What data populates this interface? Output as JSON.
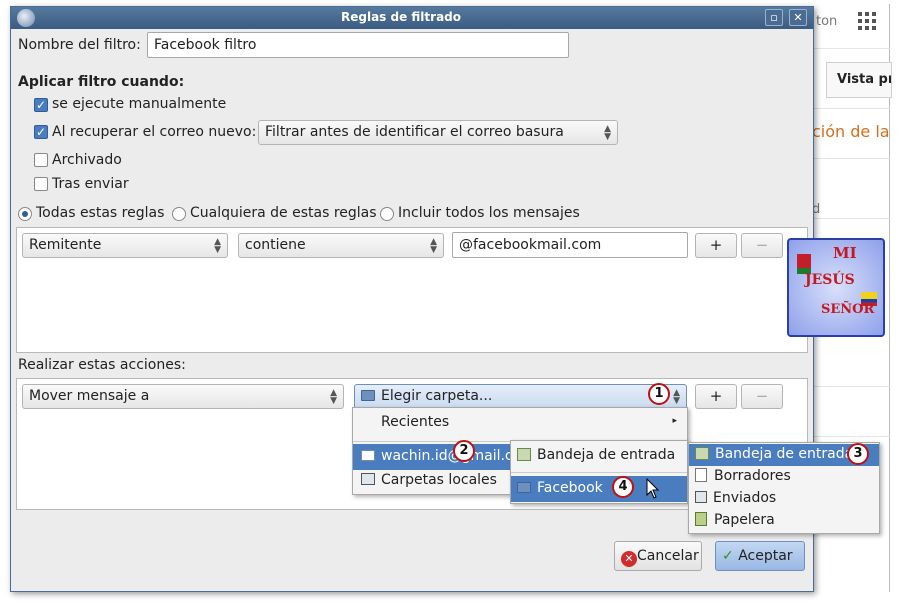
{
  "background_app": {
    "partial_header": "ton",
    "view_button": "Vista pre",
    "orange_text": "ción de la",
    "partial_letter": "d"
  },
  "dialog": {
    "title": "Reglas de filtrado",
    "filter_name_label": "Nombre del filtro:",
    "filter_name_value": "Facebook filtro",
    "apply_when_label": "Aplicar filtro cuando:",
    "manual_label": "se ejecute manualmente",
    "manual_checked": true,
    "on_fetch_label": "Al recuperar el correo nuevo:",
    "on_fetch_checked": true,
    "on_fetch_option": "Filtrar antes de identificar el correo basura",
    "archived_label": "Archivado",
    "after_send_label": "Tras enviar",
    "match_all": "Todas estas reglas",
    "match_any": "Cualquiera de estas reglas",
    "match_everything": "Incluir todos los mensajes",
    "rule": {
      "field": "Remitente",
      "operator": "contiene",
      "value": "@facebookmail.com",
      "add": "+",
      "remove": "−"
    },
    "actions_label": "Realizar estas acciones:",
    "action": {
      "type": "Mover mensaje a",
      "target": "Elegir carpeta...",
      "add": "+",
      "remove": "−"
    },
    "cancel_label": "Cancelar",
    "accept_label": "Aceptar"
  },
  "menus": {
    "level1": [
      "Recientes",
      "wachin.id@gmail.com",
      "Carpetas locales"
    ],
    "level2": [
      "Bandeja de entrada",
      "Facebook"
    ],
    "level3": [
      "Bandeja de entrada",
      "Borradores",
      "Enviados",
      "Papelera"
    ]
  },
  "badges": [
    "1",
    "2",
    "3",
    "4"
  ],
  "logo": {
    "line1": "MI",
    "line2": "JESÚS",
    "line3": "SEÑOR"
  },
  "colors": {
    "titlebar": "#3b5c82",
    "selection": "#4a7dc0",
    "badge_ring": "#c21010"
  }
}
